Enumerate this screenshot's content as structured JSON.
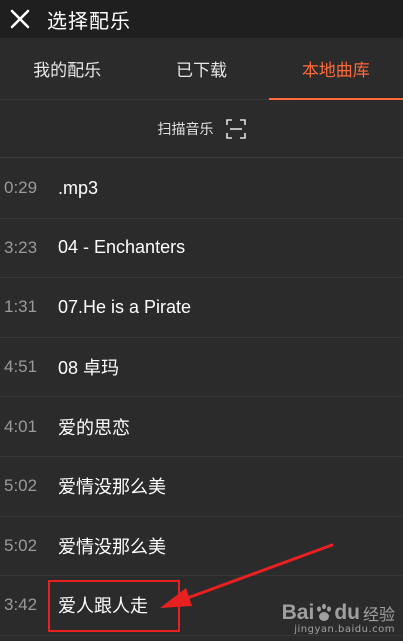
{
  "header": {
    "title": "选择配乐",
    "close_icon": "close-icon"
  },
  "tabs": [
    {
      "label": "我的配乐",
      "active": false
    },
    {
      "label": "已下载",
      "active": false
    },
    {
      "label": "本地曲库",
      "active": true
    }
  ],
  "scan": {
    "label": "扫描音乐",
    "icon": "scan-icon"
  },
  "tracks": [
    {
      "duration": "0:29",
      "name": ".mp3"
    },
    {
      "duration": "3:23",
      "name": "04 - Enchanters"
    },
    {
      "duration": "1:31",
      "name": "07.He is a Pirate"
    },
    {
      "duration": "4:51",
      "name": "08 卓玛"
    },
    {
      "duration": "4:01",
      "name": "爱的思恋"
    },
    {
      "duration": "5:02",
      "name": "爱情没那么美"
    },
    {
      "duration": "5:02",
      "name": "爱情没那么美"
    },
    {
      "duration": "3:42",
      "name": "爱人跟人走"
    }
  ],
  "annotation": {
    "highlight_color": "#e82020"
  },
  "watermark": {
    "logo_left": "Bai",
    "logo_right": "du",
    "suffix": "经验",
    "url": "jingyan.baidu.com"
  },
  "colors": {
    "accent": "#ff6a3c",
    "background": "#2b2b2b",
    "header_bg": "#1f1f1f"
  }
}
